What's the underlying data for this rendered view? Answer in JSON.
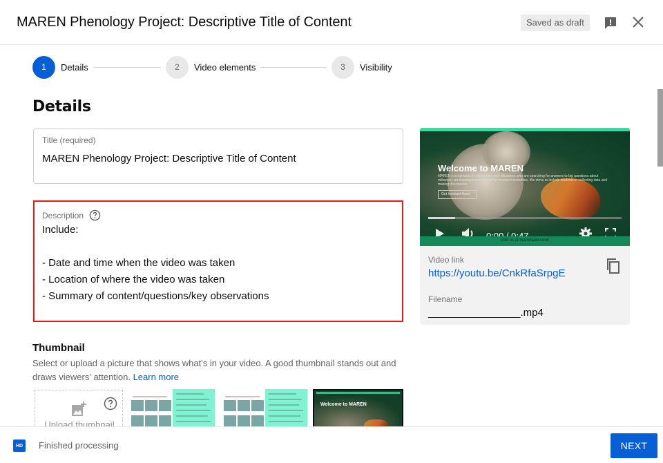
{
  "header": {
    "title": "MAREN Phenology Project: Descriptive Title of Content",
    "draft_status": "Saved as draft",
    "feedback_icon": "feedback-icon",
    "close_icon": "close-icon"
  },
  "stepper": {
    "steps": [
      {
        "number": "1",
        "label": "Details",
        "state": "active"
      },
      {
        "number": "2",
        "label": "Video elements",
        "state": "inactive"
      },
      {
        "number": "3",
        "label": "Visibility",
        "state": "inactive"
      }
    ]
  },
  "details": {
    "section_title": "Details",
    "title_field": {
      "label": "Title (required)",
      "value": "MAREN Phenology Project: Descriptive Title of Content"
    },
    "description_field": {
      "label": "Description",
      "help_icon": "help-icon",
      "value": "Include:\n\n- Date and time when the video was taken\n- Location of where the video was taken\n- Summary of content/questions/key observations",
      "highlight_color": "#e21a1a"
    },
    "thumbnail": {
      "title": "Thumbnail",
      "description": "Select or upload a picture that shows what's in your video. A good thumbnail stands out and draws viewers' attention.",
      "learn_more": "Learn more",
      "upload_label": "Upload thumbnail",
      "options": [
        {
          "type": "auto-generated",
          "selected": false
        },
        {
          "type": "auto-generated",
          "selected": false
        },
        {
          "type": "auto-generated",
          "selected": true,
          "caption": "Welcome to MAREN"
        }
      ]
    }
  },
  "preview": {
    "video": {
      "heading": "Welcome to MAREN",
      "subtext": "MAREN is a network of researchers and educators who are searching for answers to big questions about milkweed, an important food source for monarch butterflies. We strive to include students in collecting data and making discoveries.",
      "cta": "Get Involved Here!",
      "footer_text": "Visit us at marenweb.com!",
      "time_current": "0:00",
      "time_total": "0:47",
      "time_readout": "0:00 / 0:47",
      "buffered_fraction": 0.14
    },
    "video_link_label": "Video link",
    "video_link": "https://youtu.be/CnkRfaSrpgE",
    "filename_label": "Filename",
    "filename": "________________.mp4"
  },
  "footer": {
    "hd_badge": "HD",
    "status": "Finished processing",
    "next_label": "NEXT"
  },
  "colors": {
    "accent": "#065fd4",
    "highlight": "#e21a1a",
    "brand_green": "#1de9a0"
  }
}
